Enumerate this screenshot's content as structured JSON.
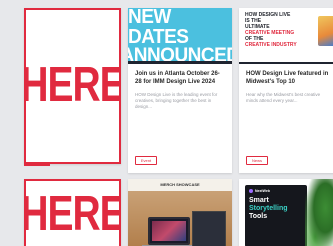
{
  "placeholders": [
    {
      "label": "HERE"
    },
    {
      "label": "HERE"
    }
  ],
  "cards": [
    {
      "banner_line1": "NEW DATES",
      "banner_line2": "ANNOUNCED",
      "title": "Join us in Atlanta October 26-28 for IMM Design Live 2024",
      "description": "HOW Design Live is the leading event for creatives, bringing together the best in design...",
      "tag": "Event"
    },
    {
      "banner_lines": [
        "HOW DESIGN LIVE",
        "IS THE",
        "ULTIMATE",
        "CREATIVE MEETING",
        "OF THE",
        "CREATIVE INDUSTRY"
      ],
      "title": "HOW Design Live featured in Midwest's Top 10",
      "description": "Hear why the Midwest's best creative minds attend every year...",
      "tag": "News"
    },
    {
      "top_label": "MERCH SHOWCASE"
    },
    {
      "logo_text": "NextWeb",
      "headline_1": "Smart",
      "headline_2": "Storytelling",
      "headline_3": "Tools"
    }
  ],
  "colors": {
    "accent_red": "#e02a3f",
    "banner_blue": "#4bc0df",
    "background": "#e7e8eb"
  }
}
